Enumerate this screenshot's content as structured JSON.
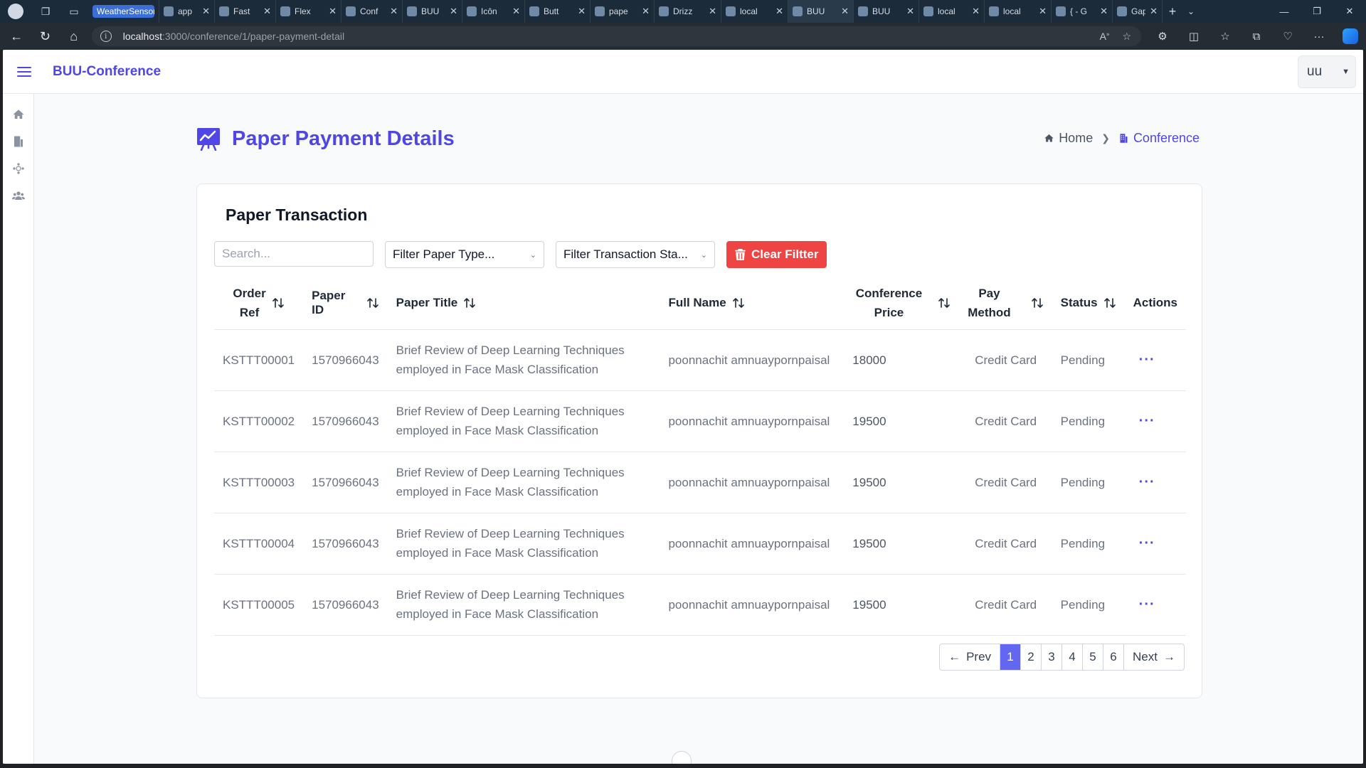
{
  "browser": {
    "tabs": [
      {
        "label": "WeatherSensor",
        "group": true
      },
      {
        "label": "app"
      },
      {
        "label": "Fast"
      },
      {
        "label": "Flex"
      },
      {
        "label": "Conf"
      },
      {
        "label": "BUU"
      },
      {
        "label": "Icôn"
      },
      {
        "label": "Butt"
      },
      {
        "label": "pape"
      },
      {
        "label": "Drizz"
      },
      {
        "label": "local"
      },
      {
        "label": "BUU",
        "active": true
      },
      {
        "label": "BUU"
      },
      {
        "label": "local"
      },
      {
        "label": "local"
      },
      {
        "label": "{ - G"
      },
      {
        "label": "Gap"
      }
    ],
    "url_host": "localhost",
    "url_path": ":3000/conference/1/paper-payment-detail"
  },
  "app": {
    "brand": "BUU-Conference",
    "user": "uu"
  },
  "page": {
    "title": "Paper Payment Details",
    "breadcrumb": {
      "home": "Home",
      "current": "Conference"
    },
    "card_title": "Paper Transaction",
    "search_placeholder": "Search...",
    "filter_paper_type": "Filter Paper Type...",
    "filter_transaction_status": "Filter Transaction Sta...",
    "clear_filter": "Clear Filtter"
  },
  "table": {
    "headers": {
      "order_ref_1": "Order",
      "order_ref_2": "Ref",
      "paper_id": "Paper ID",
      "paper_title": "Paper Title",
      "full_name": "Full Name",
      "price_1": "Conference",
      "price_2": "Price",
      "pay_1": "Pay",
      "pay_2": "Method",
      "status": "Status",
      "actions": "Actions"
    },
    "rows": [
      {
        "order_ref": "KSTTT00001",
        "paper_id": "1570966043",
        "title_1": "Brief Review of Deep Learning Techniques",
        "title_2": "employed in Face Mask Classification",
        "full_name": "poonnachit amnuaypornpaisal",
        "price": "18000",
        "pay_method": "Credit Card",
        "status": "Pending",
        "action": "···"
      },
      {
        "order_ref": "KSTTT00002",
        "paper_id": "1570966043",
        "title_1": "Brief Review of Deep Learning Techniques",
        "title_2": "employed in Face Mask Classification",
        "full_name": "poonnachit amnuaypornpaisal",
        "price": "19500",
        "pay_method": "Credit Card",
        "status": "Pending",
        "action": "···"
      },
      {
        "order_ref": "KSTTT00003",
        "paper_id": "1570966043",
        "title_1": "Brief Review of Deep Learning Techniques",
        "title_2": "employed in Face Mask Classification",
        "full_name": "poonnachit amnuaypornpaisal",
        "price": "19500",
        "pay_method": "Credit Card",
        "status": "Pending",
        "action": "···"
      },
      {
        "order_ref": "KSTTT00004",
        "paper_id": "1570966043",
        "title_1": "Brief Review of Deep Learning Techniques",
        "title_2": "employed in Face Mask Classification",
        "full_name": "poonnachit amnuaypornpaisal",
        "price": "19500",
        "pay_method": "Credit Card",
        "status": "Pending",
        "action": "···"
      },
      {
        "order_ref": "KSTTT00005",
        "paper_id": "1570966043",
        "title_1": "Brief Review of Deep Learning Techniques",
        "title_2": "employed in Face Mask Classification",
        "full_name": "poonnachit amnuaypornpaisal",
        "price": "19500",
        "pay_method": "Credit Card",
        "status": "Pending",
        "action": "···"
      }
    ]
  },
  "pagination": {
    "prev": "Prev",
    "next": "Next",
    "pages": [
      "1",
      "2",
      "3",
      "4",
      "5",
      "6"
    ],
    "current": "1"
  },
  "colors": {
    "accent": "#4f46e5",
    "danger": "#ef4444",
    "page_active": "#6366f1"
  }
}
